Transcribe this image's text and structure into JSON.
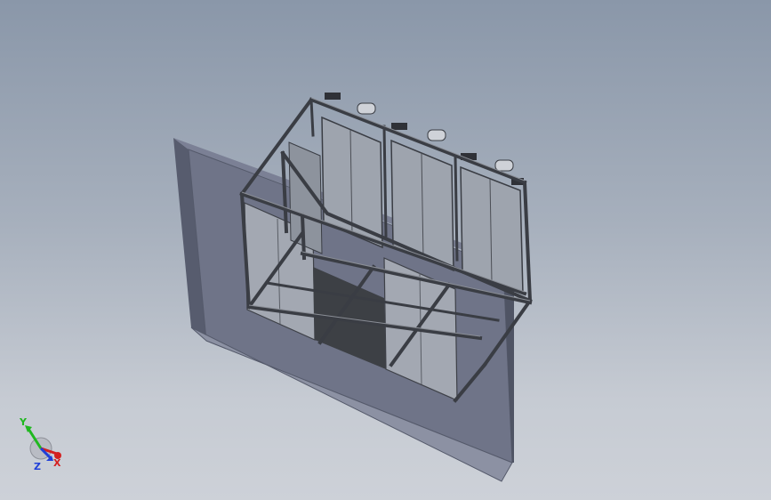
{
  "viewport": {
    "background_top": "#8a97a9",
    "background_bottom": "#cdd1d8"
  },
  "model": {
    "description_icon": "3d-frame-assembly-icon",
    "colors": {
      "wall_front": "#6f7488",
      "wall_side": "#575c6e",
      "wall_top": "#7b8095",
      "frame": "#3a3d44",
      "frame_light": "#6b6f78",
      "panel": "#9ea4ae",
      "panel_dark": "#4b4e55",
      "opening": "#3d4045"
    }
  },
  "triad": {
    "x_label": "X",
    "y_label": "Y",
    "z_label": "Z",
    "x_color": "#d42020",
    "y_color": "#1fb81f",
    "z_color": "#2040d8"
  }
}
